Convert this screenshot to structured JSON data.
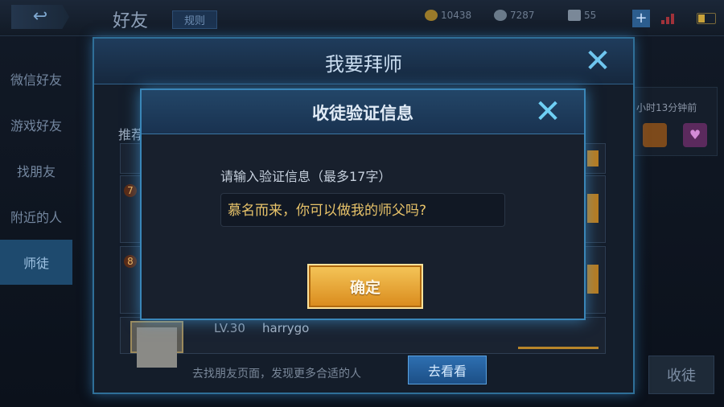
{
  "header": {
    "title": "好友",
    "rules": "规则",
    "gold": "10438",
    "diamond": "7287",
    "coupon": "55",
    "plus": "+"
  },
  "sidebar": {
    "items": [
      {
        "label": "微信好友"
      },
      {
        "label": "游戏好友"
      },
      {
        "label": "找朋友"
      },
      {
        "label": "附近的人"
      },
      {
        "label": "师徒"
      }
    ]
  },
  "right_panel": {
    "time_text": "小时13分钟前",
    "shoutu_button": "收徒"
  },
  "main_dialog": {
    "title": "我要拜师",
    "recommend_label": "推荐",
    "rows": [
      {
        "rank": ""
      },
      {
        "rank": "7"
      },
      {
        "rank": "8"
      },
      {
        "rank": "",
        "level": "LV.30",
        "name": "harrygo"
      }
    ],
    "bottom_hint": "去找朋友页面，发现更多合适的人",
    "go_button": "去看看"
  },
  "verify_dialog": {
    "title": "收徒验证信息",
    "prompt": "请输入验证信息（最多17字）",
    "input_value": "慕名而来，你可以做我的师父吗?",
    "confirm_button": "确定"
  },
  "colors": {
    "accent_blue": "#3a86b8",
    "confirm_gold": "#f0b03a",
    "input_text": "#e8c36a"
  }
}
